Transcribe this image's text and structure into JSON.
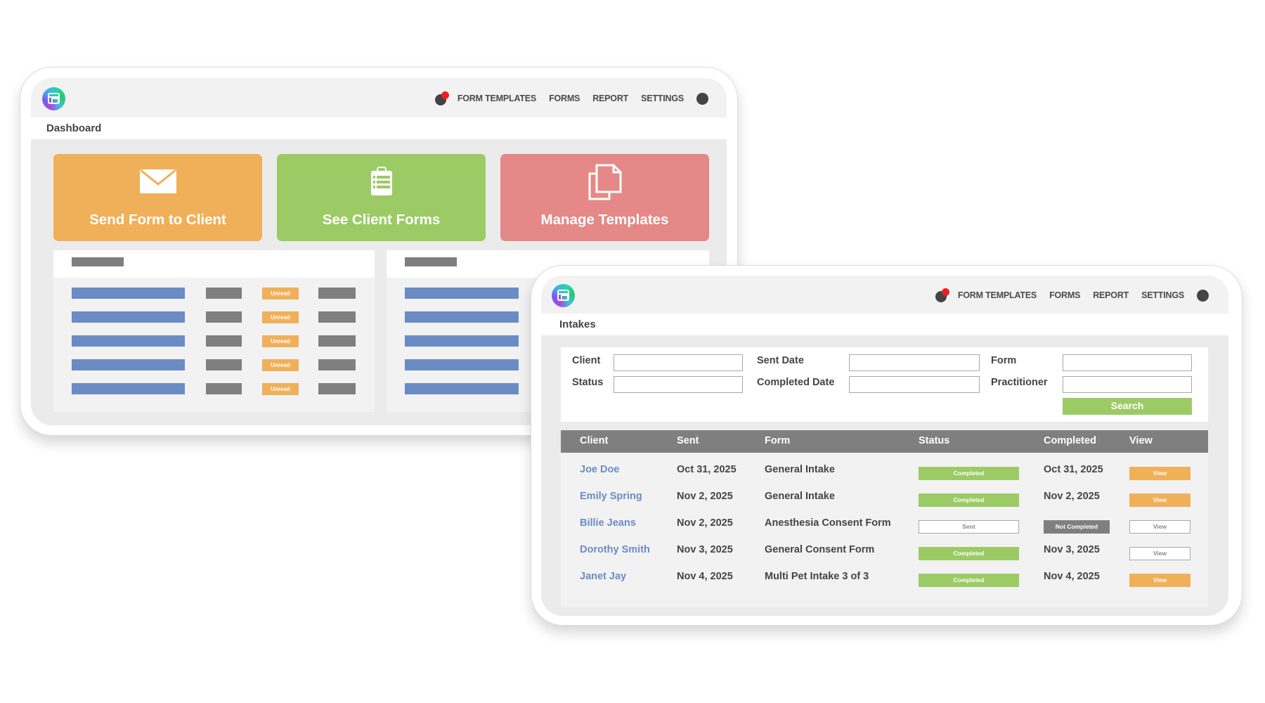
{
  "dashboard_window": {
    "nav": {
      "links": [
        "FORM TEMPLATES",
        "FORMS",
        "REPORT",
        "SETTINGS"
      ]
    },
    "page_title": "Dashboard",
    "cards": [
      {
        "label": "Send Form to Client",
        "icon": "envelope-icon",
        "color": "#f0b05a"
      },
      {
        "label": "See Client Forms",
        "icon": "clipboard-list-icon",
        "color": "#9ccb66"
      },
      {
        "label": "Manage Templates",
        "icon": "copy-documents-icon",
        "color": "#e48987"
      }
    ],
    "list_panels": [
      {
        "rows": 5,
        "badge_label": "Unread"
      },
      {
        "rows": 5
      }
    ]
  },
  "intakes_window": {
    "nav": {
      "links": [
        "FORM TEMPLATES",
        "FORMS",
        "REPORT",
        "SETTINGS"
      ]
    },
    "page_title": "Intakes",
    "filters": {
      "client_label": "Client",
      "client_value": "",
      "status_label": "Status",
      "status_value": "",
      "sent_date_label": "Sent Date",
      "sent_date_value": "",
      "completed_date_label": "Completed Date",
      "completed_date_value": "",
      "form_label": "Form",
      "form_value": "",
      "practitioner_label": "Practitioner",
      "practitioner_value": "",
      "search_label": "Search"
    },
    "table": {
      "columns": [
        "Client",
        "Sent",
        "Form",
        "Status",
        "Completed",
        "View"
      ],
      "rows": [
        {
          "client": "Joe Doe",
          "sent": "Oct 31, 2025",
          "form": "General Intake",
          "status": "Completed",
          "completed": "Oct 31, 2025",
          "view": "View",
          "view_style": "orange"
        },
        {
          "client": "Emily Spring",
          "sent": "Nov 2, 2025",
          "form": "General Intake",
          "status": "Completed",
          "completed": "Nov 2, 2025",
          "view": "View",
          "view_style": "orange"
        },
        {
          "client": "Billie Jeans",
          "sent": "Nov 2, 2025",
          "form": "Anesthesia Consent Form",
          "status": "Sent",
          "completed": "Not Completed",
          "view": "View",
          "view_style": "outline"
        },
        {
          "client": "Dorothy Smith",
          "sent": "Nov 3, 2025",
          "form": "General Consent Form",
          "status": "Completed",
          "completed": "Nov 3, 2025",
          "view": "View",
          "view_style": "outline"
        },
        {
          "client": "Janet Jay",
          "sent": "Nov 4, 2025",
          "form": "Multi Pet Intake 3 of 3",
          "status": "Completed",
          "completed": "Nov 4, 2025",
          "view": "View",
          "view_style": "orange"
        }
      ]
    }
  },
  "colors": {
    "orange": "#f0b05a",
    "green": "#9ccb66",
    "red": "#e48987",
    "blue": "#6b8bc4",
    "gray": "#7f7f7f",
    "notification": "#ee1c25"
  }
}
